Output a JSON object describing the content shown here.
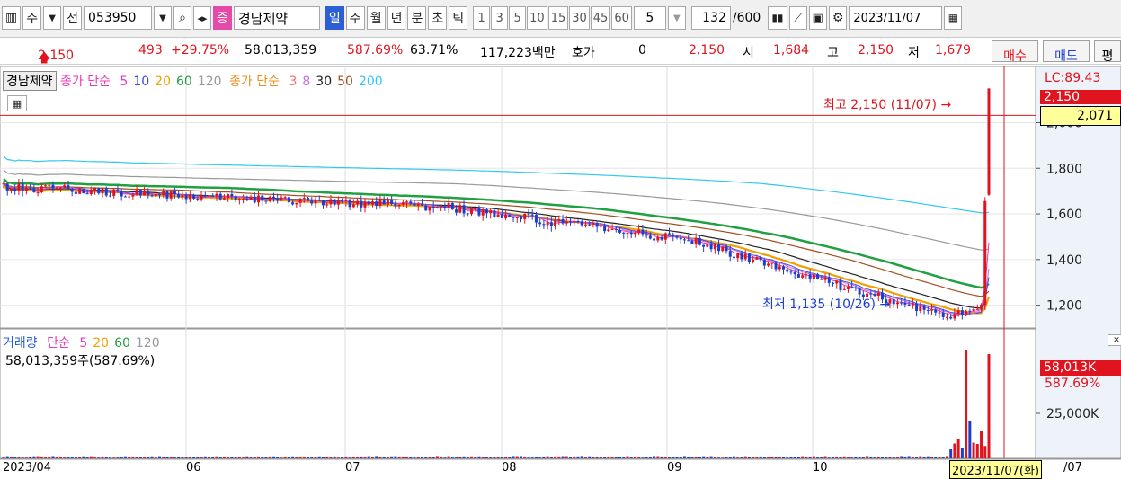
{
  "toolbar": {
    "type_label": "주",
    "jeon_label": "전",
    "code": "053950",
    "jeung_badge": "증",
    "name": "경남제약",
    "periods": [
      "일",
      "주",
      "월",
      "년",
      "분",
      "초",
      "틱"
    ],
    "selected_period": "일",
    "numbers": [
      "1",
      "3",
      "5",
      "10",
      "15",
      "30",
      "45",
      "60"
    ],
    "count_value": "5",
    "page_value": "132",
    "page_total": "/600",
    "date": "2023/11/07"
  },
  "quote": {
    "price": "2,150",
    "change": "493",
    "change_pct": "+29.75%",
    "volume": "58,013,359",
    "vol_pct": "587.69%",
    "pct2": "63.71%",
    "amount": "117,223백만",
    "hoga_label": "호가",
    "hoga_value": "0",
    "hoga_price": "2,150",
    "open_label": "시",
    "open": "1,684",
    "high_label": "고",
    "high": "2,150",
    "low_label": "저",
    "low": "1,679",
    "buy_label": "매수",
    "sell_label": "매도",
    "extra_label": "평"
  },
  "price_legend": {
    "name": "경남제약",
    "ma1_label": "종가 단순",
    "ma1_periods": [
      "5",
      "10",
      "20",
      "60",
      "120"
    ],
    "ma2_label": "종가 단순",
    "ma2_periods": [
      "3",
      "8",
      "30",
      "50",
      "200"
    ],
    "lc_label": "LC:89.43"
  },
  "annotations": {
    "high": "최고 2,150 (11/07)",
    "low": "최저 1,135 (10/26)"
  },
  "volume_legend": {
    "title": "거래량",
    "ma_label": "단순",
    "periods": [
      "5",
      "20",
      "60",
      "120"
    ],
    "value": "58,013,359주(587.69%)"
  },
  "colors": {
    "up": "#e0141e",
    "down": "#1a3fd0",
    "ma5": "#e83ab5",
    "ma10": "#3a4bd8",
    "ma20": "#f0a000",
    "ma60": "#20a040",
    "ma120": "#999999",
    "ma3": "#f07070",
    "ma8": "#c070e0",
    "ma30": "#222222",
    "ma50": "#a05020",
    "ma200": "#30c8f0"
  },
  "chart_data": {
    "type": "candlestick",
    "y_ticks": [
      1200,
      1400,
      1600,
      1800,
      2000
    ],
    "y_tick_labels": [
      "1,200",
      "1,400",
      "1,600",
      "1,800",
      "2,000"
    ],
    "current_price_tag": "2,150",
    "ma_price_tag": "2,071",
    "x_labels": [
      "2023/04",
      "06",
      "07",
      "08",
      "09",
      "10",
      "2023/11/07(화)",
      "/07"
    ],
    "volume_ticks": [
      "25,000K"
    ],
    "volume_tag": "58,013K",
    "volume_tag_pct": "587.69%",
    "last_close": 2150,
    "last_volume_k": 58013,
    "price_ylim": [
      1100,
      2250
    ],
    "volume_ylim": [
      0,
      62000
    ],
    "high_marker": 2150,
    "low_marker": 1135,
    "dates": [
      "2023/04",
      "2023/06",
      "2023/07",
      "2023/08",
      "2023/09",
      "2023/10",
      "2023/11/07"
    ],
    "ohlc_key": [
      {
        "date": "2023/10/26",
        "low": 1135
      },
      {
        "date": "2023/11/07",
        "open": 1684,
        "high": 2150,
        "low": 1679,
        "close": 2150
      }
    ]
  }
}
